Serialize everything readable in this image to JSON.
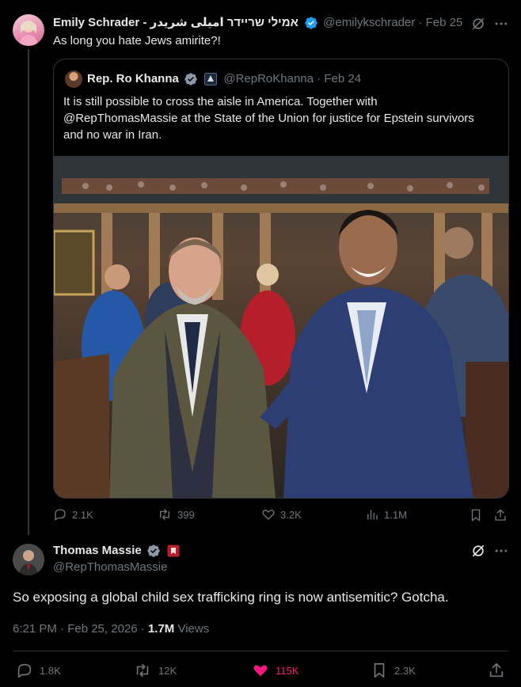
{
  "parent": {
    "name": "Emily Schrader - אמילי שריידר امیلی شریدر",
    "handle": "@emilykschrader",
    "date": "· Feb 25",
    "text": "As long you hate Jews amirite?!"
  },
  "quote": {
    "name": "Rep. Ro Khanna",
    "handle": "@RepRoKhanna",
    "date": "· Feb 24",
    "text_line1": "It is still possible to cross the aisle in America. Together with",
    "text_line2": "@RepThomasMassie at the State of the Union for justice for Epstein survivors",
    "text_line3": "and no war in Iran."
  },
  "parent_actions": {
    "replies": "2.1K",
    "reposts": "399",
    "likes": "3.2K",
    "views": "1.1M"
  },
  "main": {
    "name": "Thomas Massie",
    "handle": "@RepThomasMassie",
    "text": "So exposing a global child sex trafficking ring is now antisemitic? Gotcha.",
    "time": "6:21 PM · Feb 25, 2026 · ",
    "views_count": "1.7M",
    "views_label": " Views"
  },
  "main_actions": {
    "replies": "1.8K",
    "reposts": "12K",
    "likes": "115K",
    "bookmarks": "2.3K"
  },
  "colors": {
    "background": "#000000",
    "text": "#e7e9ea",
    "muted": "#71767b",
    "verified": "#1d9bf0",
    "like_active": "#f91880",
    "border": "#2f3336"
  }
}
